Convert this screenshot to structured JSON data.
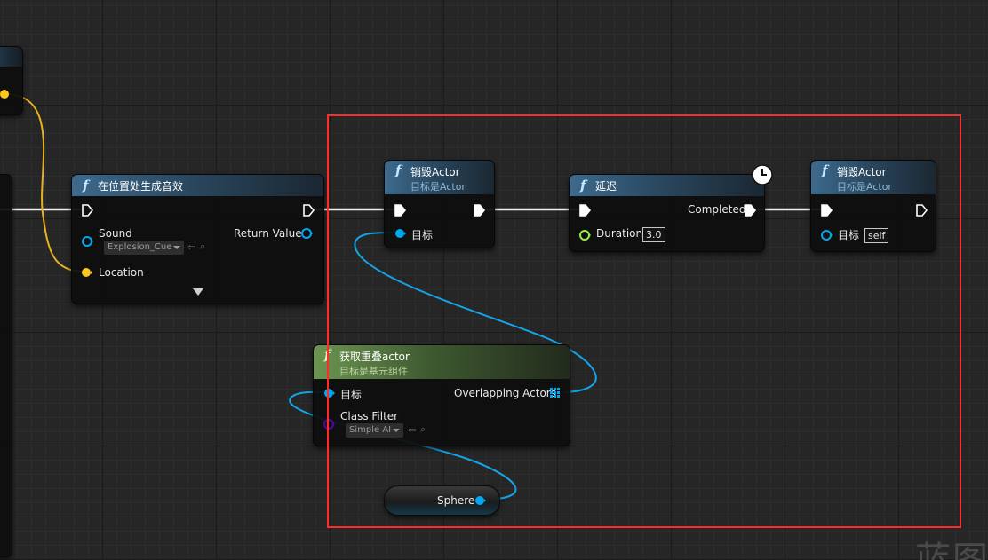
{
  "nodes": {
    "spawn_sound": {
      "title": "在位置处生成音效",
      "inputs": {
        "sound_label": "Sound",
        "sound_value": "Explosion_Cue",
        "location_label": "Location"
      },
      "outputs": {
        "return_label": "Return Value"
      }
    },
    "destroy_actor_1": {
      "title": "销毁Actor",
      "subtitle": "目标是Actor",
      "target_label": "目标"
    },
    "delay": {
      "title": "延迟",
      "completed_label": "Completed",
      "duration_label": "Duration",
      "duration_value": "3.0"
    },
    "destroy_actor_2": {
      "title": "销毁Actor",
      "subtitle": "目标是Actor",
      "target_label": "目标",
      "target_value": "self"
    },
    "get_overlapping": {
      "title": "获取重叠actor",
      "subtitle": "目标是基元组件",
      "target_label": "目标",
      "overlapping_label": "Overlapping Actors",
      "class_filter_label": "Class Filter",
      "class_filter_value": "Simple AI"
    },
    "sphere": {
      "label": "Sphere"
    }
  },
  "watermark": "蓝图",
  "colors": {
    "exec_wire": "#f2f2f2",
    "object_pin": "#00a8f2",
    "vector_pin": "#fdc71d",
    "float_pin": "#9af03b",
    "class_pin": "#5a00a8",
    "selection": "#ff2a2a",
    "function_header": "#3d6a8d",
    "pure_header": "#6c9551"
  }
}
